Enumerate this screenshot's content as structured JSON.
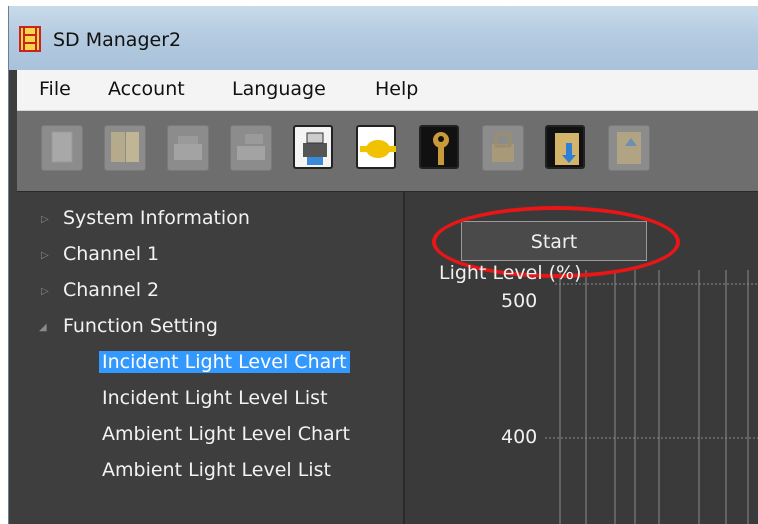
{
  "window": {
    "title": "SD Manager2"
  },
  "menu": [
    {
      "label": "File"
    },
    {
      "label": "Account"
    },
    {
      "label": "Language"
    },
    {
      "label": "Help"
    }
  ],
  "toolbar": {
    "buttons": [
      {
        "icon": "new-document-icon",
        "enabled": false
      },
      {
        "icon": "open-book-icon",
        "enabled": false
      },
      {
        "icon": "save-icon",
        "enabled": false
      },
      {
        "icon": "save-as-icon",
        "enabled": false
      },
      {
        "icon": "print-icon",
        "enabled": true
      },
      {
        "icon": "connect-icon",
        "enabled": true
      },
      {
        "icon": "key-icon",
        "enabled": true
      },
      {
        "icon": "lock-icon",
        "enabled": false
      },
      {
        "icon": "download-icon",
        "enabled": true
      },
      {
        "icon": "upload-icon",
        "enabled": false
      }
    ]
  },
  "tree": {
    "items": [
      {
        "label": "System Information",
        "expanded": false
      },
      {
        "label": "Channel 1",
        "expanded": false
      },
      {
        "label": "Channel 2",
        "expanded": false
      },
      {
        "label": "Function Setting",
        "expanded": true
      },
      {
        "label": "Incident Light Level Chart",
        "selected": true
      },
      {
        "label": "Incident Light Level List"
      },
      {
        "label": "Ambient Light Level Chart"
      },
      {
        "label": "Ambient Light Level List"
      }
    ]
  },
  "chart": {
    "start_label": "Start",
    "ylabel": "Light Level (%)",
    "ticks": [
      "500",
      "400"
    ]
  },
  "colors": {
    "selection": "#3399ff",
    "highlight_ellipse": "#e81616",
    "background": "#3e3e3e"
  }
}
